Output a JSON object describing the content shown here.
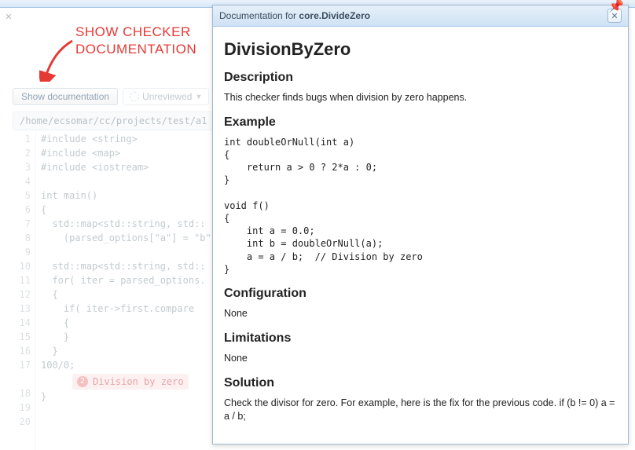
{
  "annotation": {
    "line1": "SHOW CHECKER",
    "line2": "DOCUMENTATION"
  },
  "toolbar": {
    "show_doc_label": "Show documentation",
    "review_status": "Unreviewed"
  },
  "pathbar": {
    "path": "/home/ecsomar/cc/projects/test/a1"
  },
  "code": {
    "lines": [
      "#include <string>",
      "#include <map>",
      "#include <iostream>",
      "",
      "int main()",
      "{",
      "  std::map<std::string, std::",
      "    (parsed_options[\"a\"] = \"b\"",
      "",
      "  std::map<std::string, std::",
      "  for( iter = parsed_options.",
      "  {",
      "    if( iter->first.compare",
      "    {",
      "    }",
      "  }",
      "100/0;",
      "}",
      "",
      ""
    ],
    "bug_number": "2",
    "bug_label": "Division by zero"
  },
  "doc": {
    "title_prefix": "Documentation for ",
    "title_name": "core.DivideZero",
    "h1": "DivisionByZero",
    "sec_description": "Description",
    "description_text": "This checker finds bugs when division by zero happens.",
    "sec_example": "Example",
    "example_code": "int doubleOrNull(int a)\n{\n    return a > 0 ? 2*a : 0;\n}\n\nvoid f()\n{\n    int a = 0.0;\n    int b = doubleOrNull(a);\n    a = a / b;  // Division by zero\n}",
    "sec_configuration": "Configuration",
    "configuration_text": "None",
    "sec_limitations": "Limitations",
    "limitations_text": "None",
    "sec_solution": "Solution",
    "solution_text": "Check the divisor for zero. For example, here is the fix for the previous code. if (b != 0) a = a / b;"
  }
}
